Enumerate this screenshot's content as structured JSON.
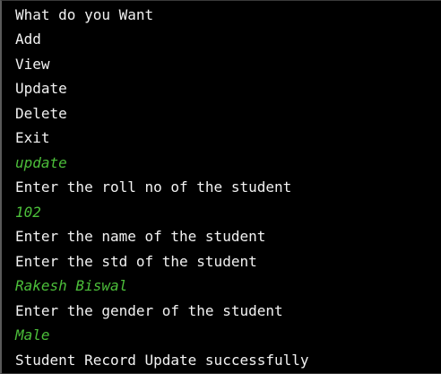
{
  "terminal": {
    "lines": [
      {
        "text": "What do you Want",
        "kind": "output"
      },
      {
        "text": "Add",
        "kind": "output"
      },
      {
        "text": "View",
        "kind": "output"
      },
      {
        "text": "Update",
        "kind": "output"
      },
      {
        "text": "Delete",
        "kind": "output"
      },
      {
        "text": "Exit",
        "kind": "output"
      },
      {
        "text": "update",
        "kind": "input"
      },
      {
        "text": "Enter the roll no of the student",
        "kind": "output"
      },
      {
        "text": "102",
        "kind": "input"
      },
      {
        "text": "Enter the name of the student",
        "kind": "output"
      },
      {
        "text": "Enter the std of the student",
        "kind": "output"
      },
      {
        "text": "Rakesh Biswal",
        "kind": "input"
      },
      {
        "text": "Enter the gender of the student",
        "kind": "output"
      },
      {
        "text": "Male",
        "kind": "input"
      },
      {
        "text": "Student Record Update successfully",
        "kind": "output"
      }
    ]
  },
  "colors": {
    "background": "#000000",
    "output_text": "#f2f2f2",
    "input_text": "#4cbf3a"
  }
}
